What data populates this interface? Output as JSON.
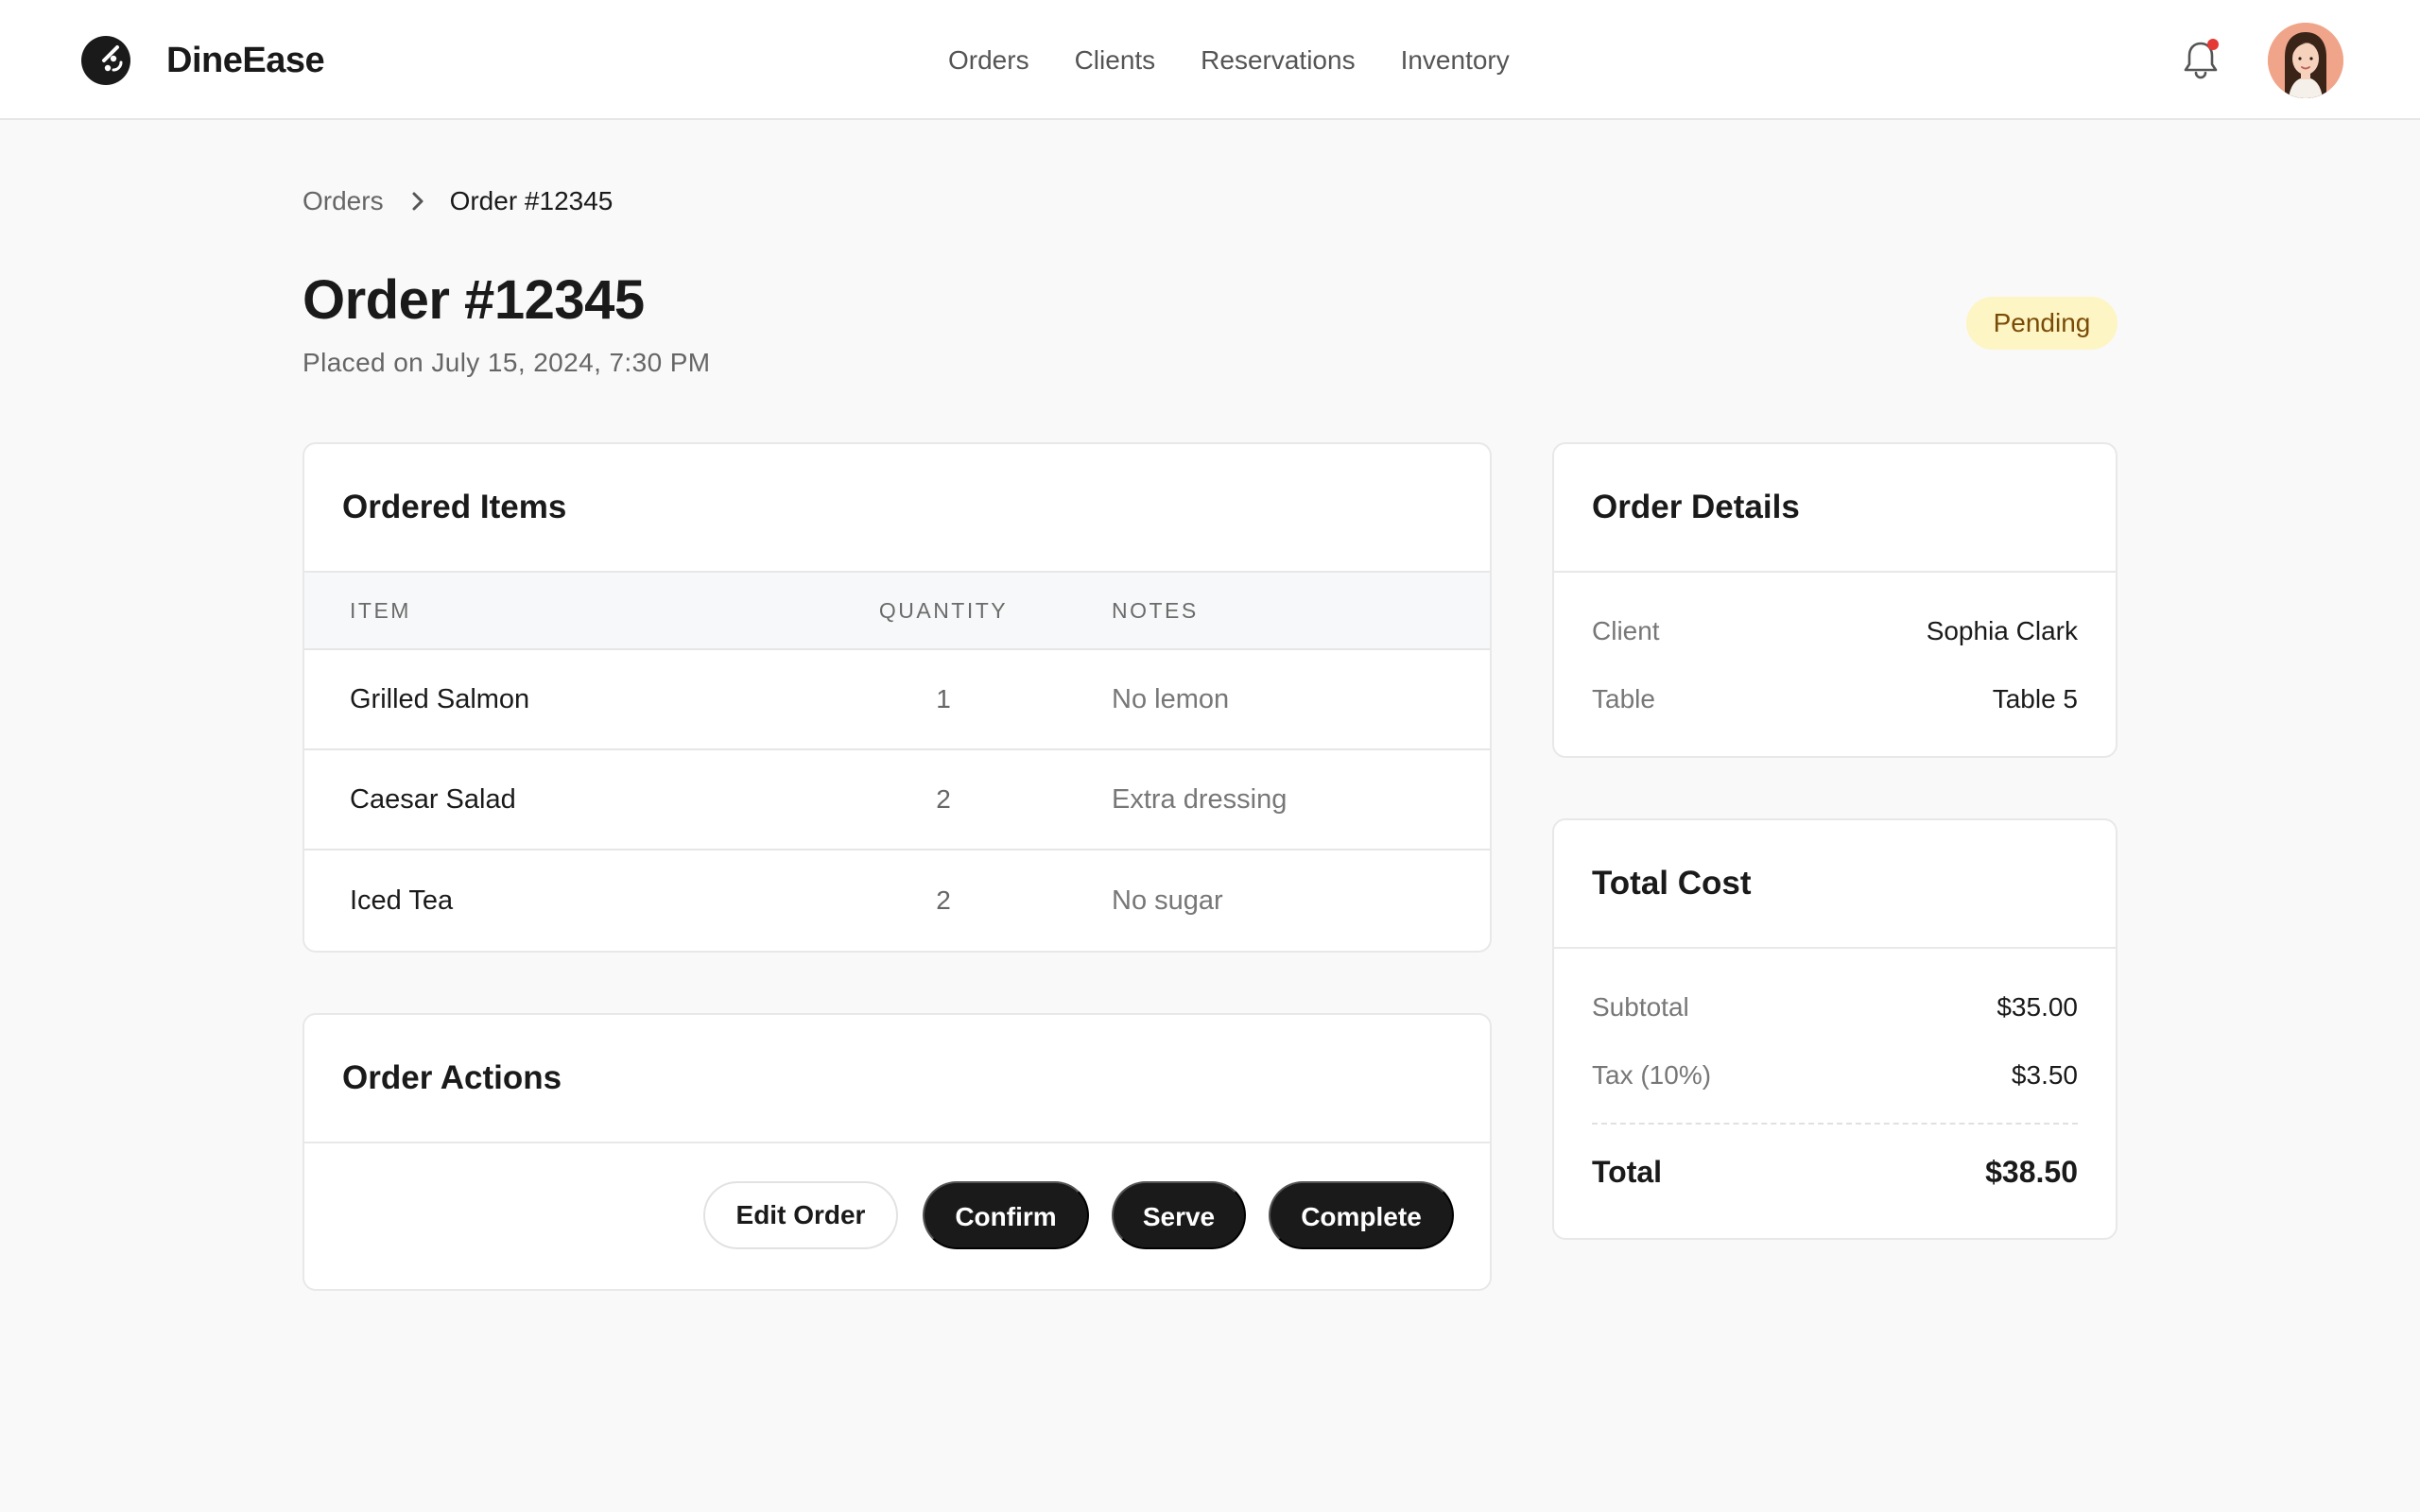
{
  "app": {
    "name": "DineEase",
    "nav": [
      {
        "label": "Orders"
      },
      {
        "label": "Clients"
      },
      {
        "label": "Reservations"
      },
      {
        "label": "Inventory"
      }
    ],
    "notifications_unread": true,
    "accent_colors": {
      "dark": "#1a1a1a",
      "badge_bg": "#fdf5c4",
      "badge_text": "#7a4b06",
      "notification_dot": "#e53935"
    }
  },
  "breadcrumb": {
    "parent": "Orders",
    "current": "Order #12345"
  },
  "order": {
    "title": "Order #12345",
    "placed": "Placed on July 15, 2024, 7:30 PM",
    "status": "Pending"
  },
  "items_card": {
    "title": "Ordered Items",
    "columns": [
      "ITEM",
      "QUANTITY",
      "NOTES"
    ],
    "rows": [
      {
        "item": "Grilled Salmon",
        "quantity": "1",
        "notes": "No lemon"
      },
      {
        "item": "Caesar Salad",
        "quantity": "2",
        "notes": "Extra dressing"
      },
      {
        "item": "Iced Tea",
        "quantity": "2",
        "notes": "No sugar"
      }
    ]
  },
  "actions_card": {
    "title": "Order Actions",
    "buttons": {
      "edit": "Edit Order",
      "confirm": "Confirm",
      "serve": "Serve",
      "complete": "Complete"
    }
  },
  "details_card": {
    "title": "Order Details",
    "client_label": "Client",
    "client_value": "Sophia Clark",
    "table_label": "Table",
    "table_value": "Table 5"
  },
  "total_card": {
    "title": "Total Cost",
    "subtotal_label": "Subtotal",
    "subtotal_value": "$35.00",
    "tax_label": "Tax (10%)",
    "tax_value": "$3.50",
    "total_label": "Total",
    "total_value": "$38.50"
  },
  "icons": {
    "logo": "dineease-logo-icon",
    "breadcrumb_separator": "chevron-right-icon",
    "notifications": "bell-icon",
    "avatar": "user-avatar"
  }
}
